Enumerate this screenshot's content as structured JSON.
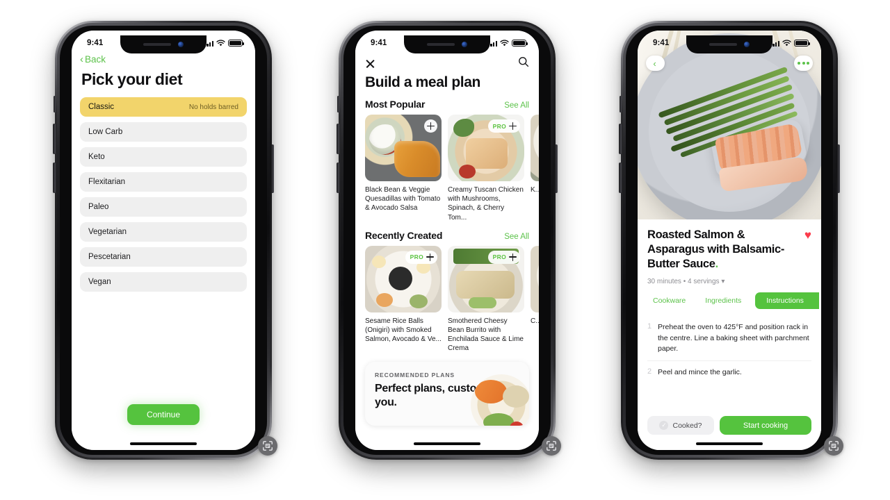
{
  "status_bar": {
    "time": "9:41",
    "signal_icon": "cellular-bars-icon",
    "wifi_icon": "wifi-icon",
    "battery_icon": "battery-full-icon"
  },
  "screen1": {
    "back_label": "Back",
    "back_icon": "chevron-left-icon",
    "title": "Pick your diet",
    "options": [
      {
        "label": "Classic",
        "note": "No holds barred",
        "selected": true
      },
      {
        "label": "Low Carb",
        "note": "",
        "selected": false
      },
      {
        "label": "Keto",
        "note": "",
        "selected": false
      },
      {
        "label": "Flexitarian",
        "note": "",
        "selected": false
      },
      {
        "label": "Paleo",
        "note": "",
        "selected": false
      },
      {
        "label": "Vegetarian",
        "note": "",
        "selected": false
      },
      {
        "label": "Pescetarian",
        "note": "",
        "selected": false
      },
      {
        "label": "Vegan",
        "note": "",
        "selected": false
      }
    ],
    "continue_label": "Continue",
    "scan_icon": "document-scan-icon"
  },
  "screen2": {
    "close_icon": "close-icon",
    "search_icon": "search-icon",
    "title": "Build a meal plan",
    "sections": [
      {
        "heading": "Most Popular",
        "see_all": "See All",
        "cards": [
          {
            "title": "Black Bean & Veggie Quesadillas with Tomato & Avocado Salsa",
            "pro": false,
            "add_icon": "plus-icon"
          },
          {
            "title": "Creamy Tuscan Chicken with Mushrooms, Spinach, & Cherry Tom...",
            "pro": true,
            "pro_label": "PRO",
            "add_icon": "plus-icon"
          },
          {
            "title": "K... B...",
            "pro": false,
            "add_icon": "plus-icon"
          }
        ]
      },
      {
        "heading": "Recently Created",
        "see_all": "See All",
        "cards": [
          {
            "title": "Sesame Rice Balls (Onigiri) with Smoked Salmon, Avocado & Ve...",
            "pro": true,
            "pro_label": "PRO",
            "add_icon": "plus-icon"
          },
          {
            "title": "Smothered Cheesy Bean Burrito with Enchilada Sauce & Lime Crema",
            "pro": true,
            "pro_label": "PRO",
            "add_icon": "plus-icon"
          },
          {
            "title": "C... (P... D...",
            "pro": false,
            "add_icon": "plus-icon"
          }
        ]
      }
    ],
    "promo": {
      "kicker": "RECOMMENDED PLANS",
      "title": "Perfect plans, customized for you."
    },
    "scan_icon": "document-scan-icon"
  },
  "screen3": {
    "back_icon": "chevron-left-icon",
    "more_icon": "more-dots-icon",
    "favorite_icon": "heart-icon",
    "title": "Roasted Salmon & Asparagus with Balsamic-Butter Sauce",
    "title_period": ".",
    "meta": "30 minutes • 4 servings",
    "meta_caret": "▾",
    "tabs": [
      {
        "label": "Cookware",
        "active": false
      },
      {
        "label": "Ingredients",
        "active": false
      },
      {
        "label": "Instructions",
        "active": true
      }
    ],
    "steps": [
      {
        "num": "1",
        "text": "Preheat the oven to 425°F and position rack in the centre. Line a baking sheet with parchment paper."
      },
      {
        "num": "2",
        "text": "Peel and mince the garlic."
      }
    ],
    "cooked_label": "Cooked?",
    "cooked_icon": "check-circle-icon",
    "start_label": "Start cooking",
    "scan_icon": "document-scan-icon"
  },
  "colors": {
    "green": "#55c33e",
    "green_text": "#5cc24a",
    "yellow": "#f2d46b",
    "grey_row": "#efefef",
    "heart_red": "#fb3b4b"
  }
}
